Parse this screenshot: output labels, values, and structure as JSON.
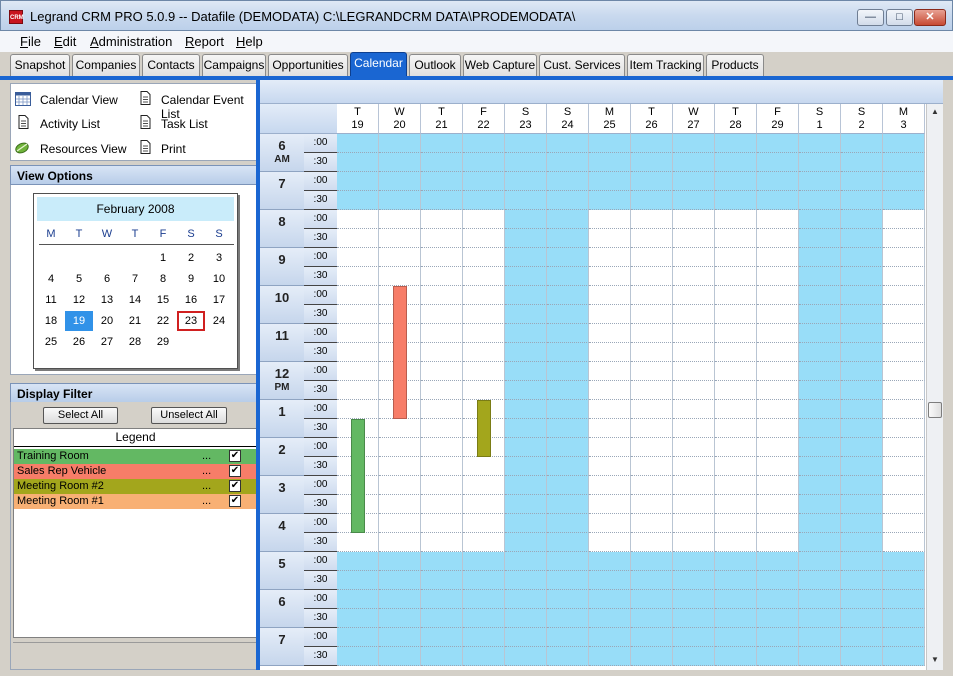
{
  "window": {
    "title": "Legrand CRM PRO 5.0.9 -- Datafile (DEMODATA) C:\\LEGRANDCRM DATA\\PRODEMODATA\\",
    "app_icon_text": "CRM",
    "minimize_icon": "minimize-icon",
    "maximize_icon": "maximize-icon",
    "close_icon": "close-icon"
  },
  "menu": [
    "File",
    "Edit",
    "Administration",
    "Report",
    "Help"
  ],
  "tabs": [
    {
      "label": "Snapshot",
      "active": false
    },
    {
      "label": "Companies",
      "active": false
    },
    {
      "label": "Contacts",
      "active": false
    },
    {
      "label": "Campaigns",
      "active": false
    },
    {
      "label": "Opportunities",
      "active": false
    },
    {
      "label": "Calendar",
      "active": true
    },
    {
      "label": "Outlook",
      "active": false
    },
    {
      "label": "Web Capture",
      "active": false
    },
    {
      "label": "Cust. Services",
      "active": false
    },
    {
      "label": "Item Tracking",
      "active": false
    },
    {
      "label": "Products",
      "active": false
    }
  ],
  "view_links": {
    "calendar_view": {
      "label": "Calendar View",
      "icon": "calendar-icon"
    },
    "calendar_event_list": {
      "label": "Calendar Event List",
      "icon": "document-icon"
    },
    "activity_list": {
      "label": "Activity List",
      "icon": "document-icon"
    },
    "task_list": {
      "label": "Task List",
      "icon": "document-icon"
    },
    "resources_view": {
      "label": "Resources View",
      "icon": "resources-icon"
    },
    "print": {
      "label": "Print",
      "icon": "document-icon"
    }
  },
  "view_options": {
    "header": "View Options",
    "mini_calendar": {
      "month_label": "February 2008",
      "weekdays": [
        "M",
        "T",
        "W",
        "T",
        "F",
        "S",
        "S"
      ],
      "weeks": [
        [
          "",
          "",
          "",
          "",
          "1",
          "2",
          "3"
        ],
        [
          "4",
          "5",
          "6",
          "7",
          "8",
          "9",
          "10"
        ],
        [
          "11",
          "12",
          "13",
          "14",
          "15",
          "16",
          "17"
        ],
        [
          "18",
          "19",
          "20",
          "21",
          "22",
          "23",
          "24"
        ],
        [
          "25",
          "26",
          "27",
          "28",
          "29",
          "",
          ""
        ]
      ],
      "selected_day": "19",
      "today": "23"
    }
  },
  "display_filter": {
    "header": "Display Filter",
    "select_all": "Select All",
    "unselect_all": "Unselect All",
    "legend_header": "Legend",
    "items": [
      {
        "label": "Training Room",
        "color": "#63b863",
        "ellipsis": "...",
        "checked": true
      },
      {
        "label": "Sales Rep Vehicle",
        "color": "#f77d68",
        "ellipsis": "...",
        "checked": true
      },
      {
        "label": "Meeting Room #2",
        "color": "#a3a61c",
        "ellipsis": "...",
        "checked": true
      },
      {
        "label": "Meeting Room #1",
        "color": "#f8b074",
        "ellipsis": "...",
        "checked": true
      }
    ]
  },
  "calendar": {
    "days": [
      {
        "dow": "T",
        "date": "19",
        "weekend": false
      },
      {
        "dow": "W",
        "date": "20",
        "weekend": false
      },
      {
        "dow": "T",
        "date": "21",
        "weekend": false
      },
      {
        "dow": "F",
        "date": "22",
        "weekend": false
      },
      {
        "dow": "S",
        "date": "23",
        "weekend": true
      },
      {
        "dow": "S",
        "date": "24",
        "weekend": true
      },
      {
        "dow": "M",
        "date": "25",
        "weekend": false
      },
      {
        "dow": "T",
        "date": "26",
        "weekend": false
      },
      {
        "dow": "W",
        "date": "27",
        "weekend": false
      },
      {
        "dow": "T",
        "date": "28",
        "weekend": false
      },
      {
        "dow": "F",
        "date": "29",
        "weekend": false
      },
      {
        "dow": "S",
        "date": "1",
        "weekend": true
      },
      {
        "dow": "S",
        "date": "2",
        "weekend": true
      },
      {
        "dow": "M",
        "date": "3",
        "weekend": false
      }
    ],
    "hours": [
      {
        "label": "6",
        "ampm": "AM"
      },
      {
        "label": "7",
        "ampm": ""
      },
      {
        "label": "8",
        "ampm": ""
      },
      {
        "label": "9",
        "ampm": ""
      },
      {
        "label": "10",
        "ampm": ""
      },
      {
        "label": "11",
        "ampm": ""
      },
      {
        "label": "12",
        "ampm": "PM"
      },
      {
        "label": "1",
        "ampm": ""
      },
      {
        "label": "2",
        "ampm": ""
      },
      {
        "label": "3",
        "ampm": ""
      },
      {
        "label": "4",
        "ampm": ""
      },
      {
        "label": "5",
        "ampm": ""
      },
      {
        "label": "6",
        "ampm": ""
      },
      {
        "label": "7",
        "ampm": ""
      }
    ],
    "minute_labels": [
      ":00",
      ":30"
    ],
    "work_start_hour": 8,
    "work_end_hour": 17,
    "first_hour": 6,
    "colors": {
      "off_hours": "#98ddf8",
      "work_hours": "#ffffff"
    },
    "events": [
      {
        "day_index": 0,
        "start": 13.5,
        "end": 16.5,
        "resource": "Training Room",
        "color": "#63b863"
      },
      {
        "day_index": 1,
        "start": 10.0,
        "end": 13.5,
        "resource": "Sales Rep Vehicle",
        "color": "#f77d68"
      },
      {
        "day_index": 3,
        "start": 13.0,
        "end": 14.5,
        "resource": "Meeting Room #2",
        "color": "#a3a61c"
      }
    ]
  }
}
